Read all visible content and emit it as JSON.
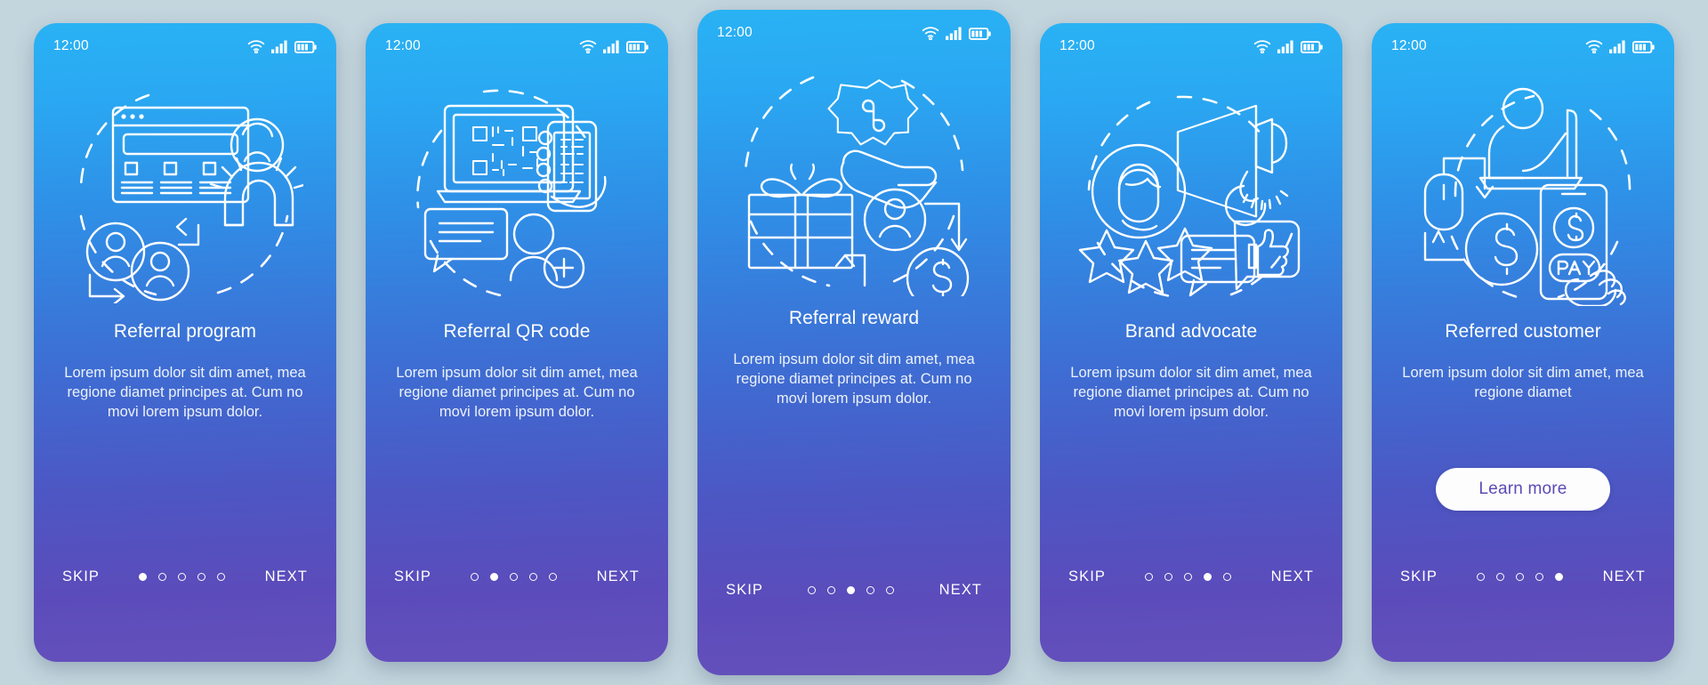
{
  "background_color": "#c3d5dd",
  "card_gradient": {
    "from": "#29b2f4",
    "to": "#6450bb"
  },
  "status_bar": {
    "time": "12:00",
    "icons": [
      "wifi-icon",
      "cellular-signal-icon",
      "battery-icon"
    ]
  },
  "nav": {
    "skip_label": "SKIP",
    "next_label": "NEXT",
    "total_dots": 5
  },
  "screens": [
    {
      "id": "referral-program",
      "title": "Referral program",
      "body": "Lorem ipsum dolor sit dim amet, mea regione diamet principes at. Cum no movi lorem ipsum dolor.",
      "illustration": "browser-users-magnet-illustration",
      "active_dot": 1,
      "cta": null
    },
    {
      "id": "referral-qr-code",
      "title": "Referral QR code",
      "body": "Lorem ipsum dolor sit dim amet, mea regione diamet principes at. Cum no movi lorem ipsum dolor.",
      "illustration": "laptop-qr-phone-illustration",
      "active_dot": 2,
      "cta": null
    },
    {
      "id": "referral-reward",
      "title": "Referral reward",
      "body": "Lorem ipsum dolor sit dim amet, mea regione diamet principes at. Cum no movi lorem ipsum dolor.",
      "illustration": "gift-hand-coin-illustration",
      "active_dot": 3,
      "cta": null
    },
    {
      "id": "brand-advocate",
      "title": "Brand advocate",
      "body": "Lorem ipsum dolor sit dim amet, mea regione diamet principes at. Cum no movi lorem ipsum dolor.",
      "illustration": "megaphone-stars-thumbsup-illustration",
      "active_dot": 4,
      "cta": null
    },
    {
      "id": "referred-customer",
      "title": "Referred customer",
      "body": "Lorem ipsum dolor sit dim amet, mea regione diamet",
      "illustration": "person-laptop-pay-illustration",
      "active_dot": 5,
      "cta": {
        "label": "Learn more",
        "text_color": "#5b4bb6",
        "background": "#fdfdfd"
      }
    }
  ]
}
